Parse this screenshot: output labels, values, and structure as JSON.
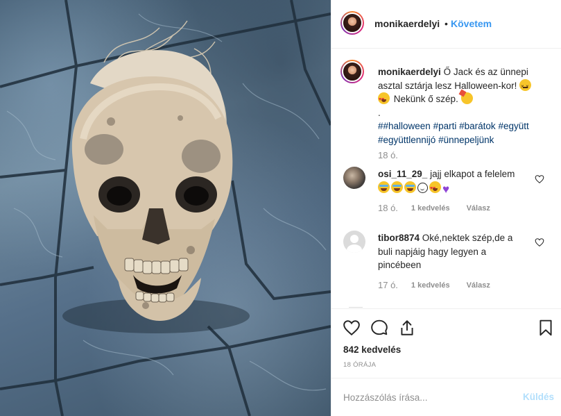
{
  "header": {
    "username": "monikaerdelyi",
    "separator": "•",
    "follow_label": "Követem",
    "more_icon": "more-horizontal-icon"
  },
  "caption": {
    "username": "monikaerdelyi",
    "text_1": "Ő Jack és az ünnepi asztal sztárja lesz Halloween-kor!",
    "text_2": "Nekünk ő szép.",
    "dot_line": ".",
    "hashtags": [
      "#",
      "#halloween",
      "#parti",
      "#barátok",
      "#együtt",
      "#együttlennijó",
      "#ünnepeljünk"
    ],
    "time": "18 ó."
  },
  "comments": [
    {
      "username": "osi_11_29_",
      "text": "jajj elkapot a felelem",
      "emoji": [
        "tears-of-joy",
        "tears-of-joy",
        "tears-of-joy",
        "smiling-face",
        "heart-eyes",
        "purple-heart"
      ],
      "time": "18 ó.",
      "likes": "1 kedvelés",
      "reply": "Válasz"
    },
    {
      "username": "tibor8874",
      "text": "Oké,nektek szép,de a buli napjáig hagy legyen a pincébeen",
      "time": "17 ó.",
      "likes": "1 kedvelés",
      "reply": "Válasz"
    }
  ],
  "actions": {
    "icons": [
      "heart-icon",
      "comment-icon",
      "share-icon",
      "bookmark-icon"
    ],
    "likes_count": "842 kedvelés",
    "post_age": "18 ÓRÁJA"
  },
  "composer": {
    "placeholder": "Hozzászólás írása...",
    "send_label": "Küldés"
  },
  "colors": {
    "link_blue": "#3897f0",
    "hashtag_blue": "#003569",
    "muted_gray": "#8e8e8e",
    "send_disabled": "#b2dffc"
  }
}
